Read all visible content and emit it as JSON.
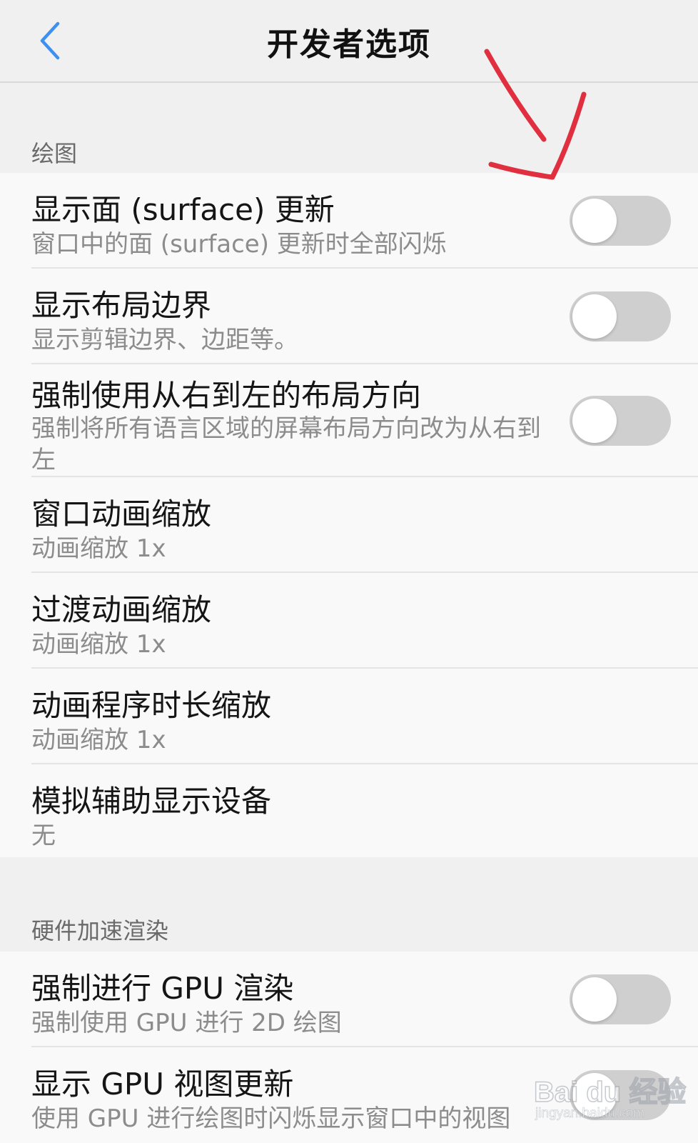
{
  "header": {
    "title": "开发者选项",
    "back_icon": "chevron-left-icon",
    "accent_color": "#3d8ff0"
  },
  "sections": [
    {
      "title": "绘图",
      "rows": [
        {
          "title": "显示面 (surface) 更新",
          "subtitle": "窗口中的面 (surface) 更新时全部闪烁",
          "toggle": false
        },
        {
          "title": "显示布局边界",
          "subtitle": "显示剪辑边界、边距等。",
          "toggle": false
        },
        {
          "title": "强制使用从右到左的布局方向",
          "subtitle": "强制将所有语言区域的屏幕布局方向改为从右到左",
          "toggle": false
        },
        {
          "title": "窗口动画缩放",
          "subtitle": "动画缩放 1x"
        },
        {
          "title": "过渡动画缩放",
          "subtitle": "动画缩放 1x"
        },
        {
          "title": "动画程序时长缩放",
          "subtitle": "动画缩放 1x"
        },
        {
          "title": "模拟辅助显示设备",
          "subtitle": "无"
        }
      ]
    },
    {
      "title": "硬件加速渲染",
      "rows": [
        {
          "title": "强制进行 GPU 渲染",
          "subtitle": "强制使用 GPU 进行 2D 绘图",
          "toggle": false
        },
        {
          "title": "显示 GPU 视图更新",
          "subtitle": "使用 GPU 进行绘图时闪烁显示窗口中的视图",
          "toggle": false
        }
      ]
    }
  ],
  "colors": {
    "background": "#f0f0f0",
    "card": "#f9f9f9",
    "toggle_off": "#cfcfcf",
    "annotation": "#e0303f"
  },
  "annotation": {
    "icon": "red-arrow-icon"
  },
  "watermark": {
    "line1": "Bai du 经验",
    "line2": "jingyan.baidu.com"
  }
}
